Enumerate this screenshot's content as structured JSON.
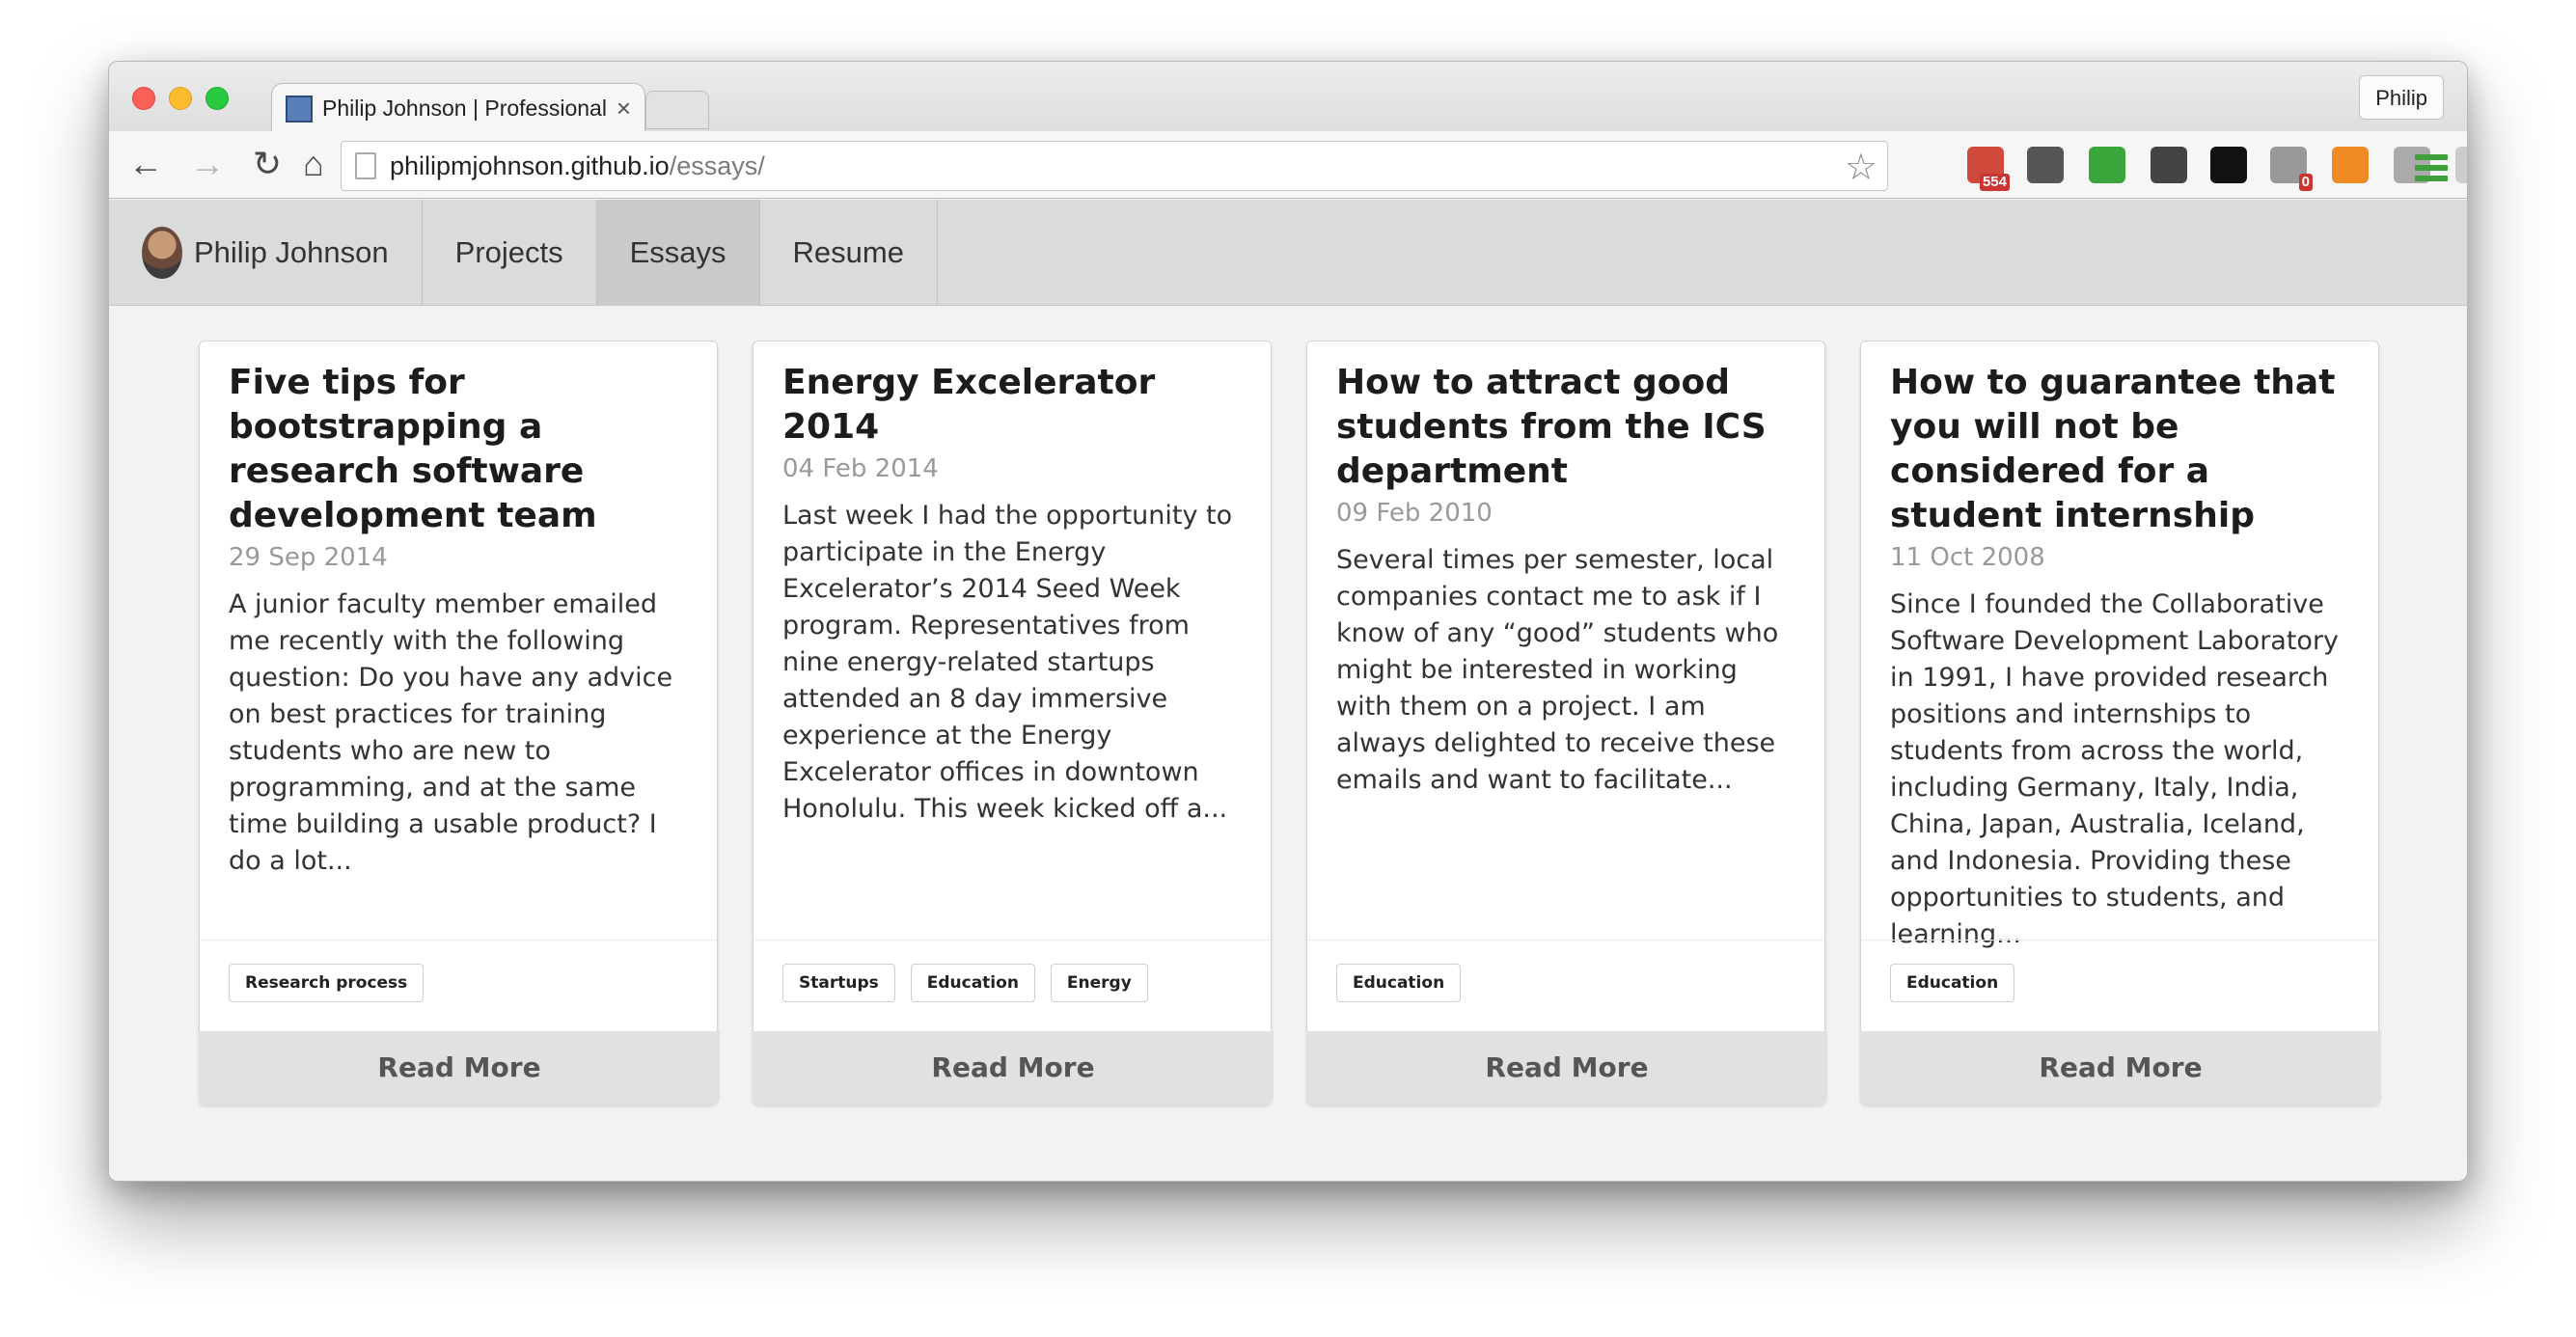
{
  "browser": {
    "tab_title": "Philip Johnson | Professional Portfolio",
    "tab_close": "×",
    "profile_name": "Philip",
    "url_host": "philipmjohnson.github.io",
    "url_path": "/essays/",
    "nav": {
      "back": "←",
      "forward": "→",
      "reload": "↻",
      "home": "⌂"
    },
    "extensions": [
      {
        "icon": "calendar-extension-icon",
        "badge": "554",
        "color": "#d04a3c"
      },
      {
        "icon": "sync-extension-icon",
        "badge": "",
        "color": "#555555"
      },
      {
        "icon": "evernote-extension-icon",
        "badge": "",
        "color": "#3aa53a"
      },
      {
        "icon": "onepassword-extension-icon",
        "badge": "",
        "color": "#444444"
      },
      {
        "icon": "jetbrains-extension-icon",
        "badge": "",
        "color": "#111111"
      },
      {
        "icon": "ghostery-extension-icon",
        "badge": "0",
        "color": "#999999"
      },
      {
        "icon": "analytics-extension-icon",
        "badge": "",
        "color": "#f08a24"
      },
      {
        "icon": "link-extension-icon",
        "badge": "",
        "color": "#aaaaaa"
      },
      {
        "icon": "drive-extension-icon",
        "badge": "",
        "color": "#cccccc"
      }
    ]
  },
  "sitenav": {
    "brand": "Philip Johnson",
    "items": [
      "Projects",
      "Essays",
      "Resume"
    ],
    "active": "Essays"
  },
  "cards": [
    {
      "title": "Five tips for bootstrapping a research software development team",
      "date": "29 Sep 2014",
      "description": "A junior faculty member emailed me recently with the following question: Do you have any advice on best practices for training students who are new to programming, and at the same time building a usable product? I do a lot...",
      "tags": [
        "Research process"
      ],
      "button": "Read More"
    },
    {
      "title": "Energy Excelerator 2014",
      "date": "04 Feb 2014",
      "description": "Last week I had the opportunity to participate in the Energy Excelerator’s 2014 Seed Week program. Representatives from nine energy-related startups attended an 8 day immersive experience at the Energy Excelerator offices in downtown Honolulu. This week kicked off a...",
      "tags": [
        "Startups",
        "Education",
        "Energy"
      ],
      "button": "Read More"
    },
    {
      "title": "How to attract good students from the ICS department",
      "date": "09 Feb 2010",
      "description": "Several times per semester, local companies contact me to ask if I know of any “good” students who might be interested in working with them on a project. I am always delighted to receive these emails and want to facilitate...",
      "tags": [
        "Education"
      ],
      "button": "Read More"
    },
    {
      "title": "How to guarantee that you will not be considered for a student internship",
      "date": "11 Oct 2008",
      "description": "Since I founded the Collaborative Software Development Laboratory in 1991, I have provided research positions and internships to students from across the world, including Germany, Italy, India, China, Japan, Australia, Iceland, and Indonesia. Providing these opportunities to students, and learning...",
      "tags": [
        "Education"
      ],
      "button": "Read More"
    }
  ]
}
